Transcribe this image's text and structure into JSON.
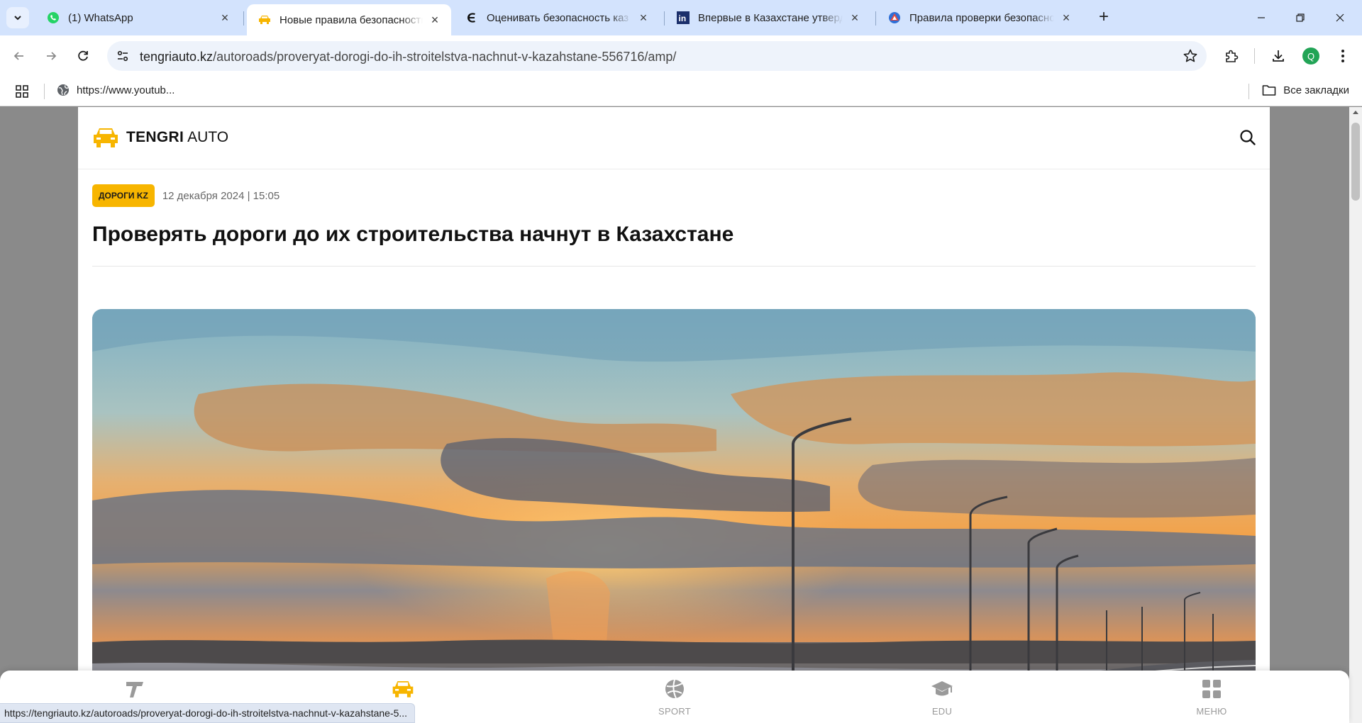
{
  "tabs": [
    {
      "title": "(1) WhatsApp",
      "active": false,
      "icon": "whatsapp-icon"
    },
    {
      "title": "Новые правила безопасности",
      "active": true,
      "icon": "tengri-car-icon"
    },
    {
      "title": "Оценивать безопасность каз",
      "active": false,
      "icon": "e-logo-icon"
    },
    {
      "title": "Впервые в Казахстане утверди",
      "active": false,
      "icon": "in-logo-icon"
    },
    {
      "title": "Правила проверки безопасно",
      "active": false,
      "icon": "triangle-logo-icon"
    }
  ],
  "omnibox": {
    "domain": "tengriauto.kz",
    "path": "/autoroads/proveryat-dorogi-do-ih-stroitelstva-nachnut-v-kazahstane-556716/amp/"
  },
  "profile": {
    "initial": "Q",
    "color": "#22a456"
  },
  "bookmarks": {
    "item": "https://www.youtub...",
    "all": "Все закладки"
  },
  "site": {
    "brand_bold": "TENGRI",
    "brand_light": "AUTO",
    "accent": "#f7b500"
  },
  "article": {
    "category": "ДОРОГИ KZ",
    "date": "12 декабря 2024 | 15:05",
    "title": "Проверять дороги до их строительства начнут в Казахстане"
  },
  "bottom_nav": [
    {
      "label": "",
      "icon": "tengri-t-icon"
    },
    {
      "label": "",
      "icon": "auto-car-icon"
    },
    {
      "label": "SPORT",
      "icon": "ball-icon"
    },
    {
      "label": "EDU",
      "icon": "graduation-cap-icon"
    },
    {
      "label": "МЕНЮ",
      "icon": "grid-menu-icon"
    }
  ],
  "status_url": "https://tengriauto.kz/autoroads/proveryat-dorogi-do-ih-stroitelstva-nachnut-v-kazahstane-5..."
}
